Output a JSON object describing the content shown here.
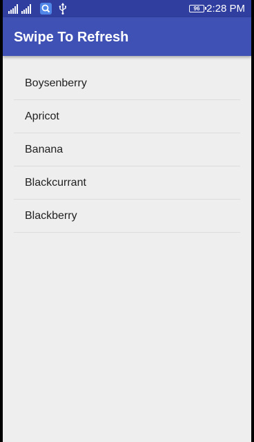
{
  "status_bar": {
    "time": "2:28 PM",
    "battery_level": "96",
    "icons": [
      "signal-icon",
      "search-icon",
      "usb-icon",
      "battery-icon"
    ]
  },
  "app_bar": {
    "title": "Swipe To Refresh"
  },
  "list": {
    "items": [
      {
        "label": "Boysenberry"
      },
      {
        "label": "Apricot"
      },
      {
        "label": "Banana"
      },
      {
        "label": "Blackcurrant"
      },
      {
        "label": "Blackberry"
      }
    ]
  },
  "colors": {
    "status_bar": "#303f9f",
    "app_bar": "#3f51b5",
    "background": "#eeeeee",
    "divider": "#dcdcdc"
  }
}
